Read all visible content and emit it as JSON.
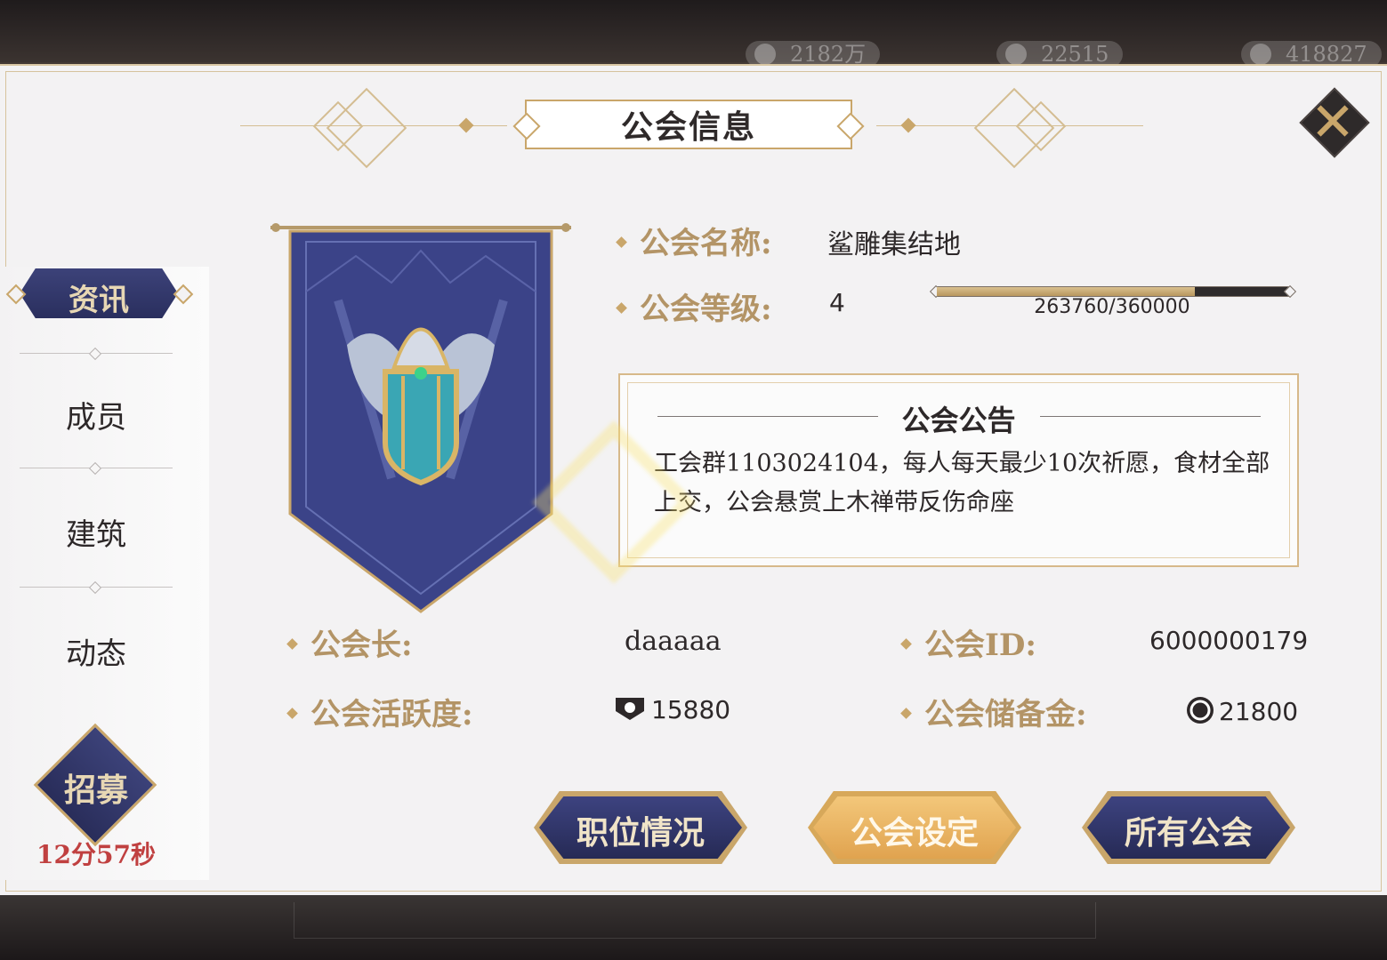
{
  "topbar": {
    "resources": [
      {
        "name": "resource-1",
        "value": "2182万"
      },
      {
        "name": "resource-2",
        "value": "22515"
      },
      {
        "name": "resource-3",
        "value": "418827"
      }
    ]
  },
  "title": "公会信息",
  "sidebar": {
    "tabs": [
      {
        "label": "资讯",
        "active": true
      },
      {
        "label": "成员",
        "active": false
      },
      {
        "label": "建筑",
        "active": false
      },
      {
        "label": "动态",
        "active": false
      }
    ],
    "recruit_label": "招募",
    "recruit_timer": "12分57秒"
  },
  "info": {
    "name_label": "公会名称:",
    "name_value": "鲨雕集结地",
    "level_label": "公会等级:",
    "level_value": "4",
    "xp_text": "263760/360000",
    "xp_current": 263760,
    "xp_max": 360000,
    "leader_label": "公会长:",
    "leader_value": "daaaaa",
    "id_label": "公会ID:",
    "id_value": "6000000179",
    "activity_label": "公会活跃度:",
    "activity_value": "15880",
    "reserve_label": "公会储备金:",
    "reserve_value": "21800"
  },
  "announcement": {
    "title": "公会公告",
    "text": "工会群1103024104，每人每天最少10次祈愿，食材全部上交，公会悬赏上木禅带反伤命座"
  },
  "buttons": {
    "positions": "职位情况",
    "settings": "公会设定",
    "all_guilds": "所有公会"
  },
  "colors": {
    "accent_gold": "#c9a66a",
    "navy": "#2f3468",
    "label_tan": "#b39466",
    "timer_red": "#c04040"
  }
}
